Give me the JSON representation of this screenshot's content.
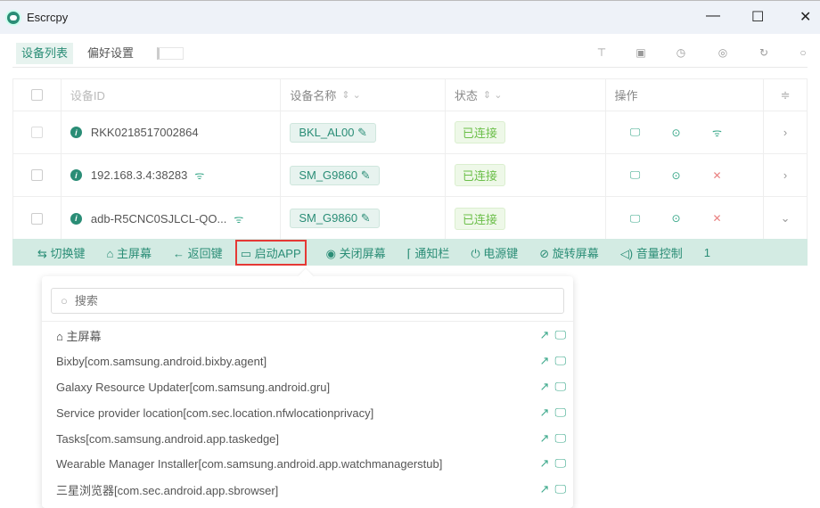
{
  "window": {
    "title": "Escrcpy",
    "minimize": "—",
    "maximize": "☐",
    "close": "✕"
  },
  "tabs": [
    {
      "label": "设备列表"
    },
    {
      "label": "偏好设置"
    }
  ],
  "table": {
    "headers": {
      "id": "设备ID",
      "name": "设备名称",
      "status": "状态",
      "actions": "操作"
    },
    "rows": [
      {
        "id": "RKK0218517002864",
        "wifi": false,
        "name": "BKL_AL00",
        "status": "已连接",
        "third_op": "wifi",
        "expand": "›"
      },
      {
        "id": "192.168.3.4:38283",
        "wifi": true,
        "name": "SM_G9860",
        "status": "已连接",
        "third_op": "disconnect",
        "expand": "›"
      },
      {
        "id": "adb-R5CNC0SJLCL-QO...",
        "wifi": true,
        "name": "SM_G9860",
        "status": "已连接",
        "third_op": "disconnect",
        "expand": "⌄"
      }
    ]
  },
  "actionbar": {
    "items": [
      {
        "icon": "⇆",
        "label": "切换键"
      },
      {
        "icon": "⌂",
        "label": "主屏幕"
      },
      {
        "icon": "←",
        "label": "返回键"
      },
      {
        "icon": "▭",
        "label": "启动APP",
        "selected": true
      },
      {
        "icon": "◉",
        "label": "关闭屏幕"
      },
      {
        "icon": "⌈",
        "label": "通知栏"
      },
      {
        "icon": "⏻",
        "label": "电源键"
      },
      {
        "icon": "⊘",
        "label": "旋转屏幕"
      },
      {
        "icon": "◁)",
        "label": "音量控制"
      }
    ],
    "more": "1"
  },
  "popover": {
    "search_placeholder": "搜索",
    "home_label": "主屏幕",
    "apps": [
      "Bixby[com.samsung.android.bixby.agent]",
      "Galaxy Resource Updater[com.samsung.android.gru]",
      "Service provider location[com.sec.location.nfwlocationprivacy]",
      "Tasks[com.samsung.android.app.taskedge]",
      "Wearable Manager Installer[com.samsung.android.app.watchmanagerstub]",
      "三星浏览器[com.sec.android.app.sbrowser]"
    ]
  },
  "colors": {
    "accent": "#2a8d76",
    "status": "#6cbf4a",
    "danger": "#e53935"
  }
}
